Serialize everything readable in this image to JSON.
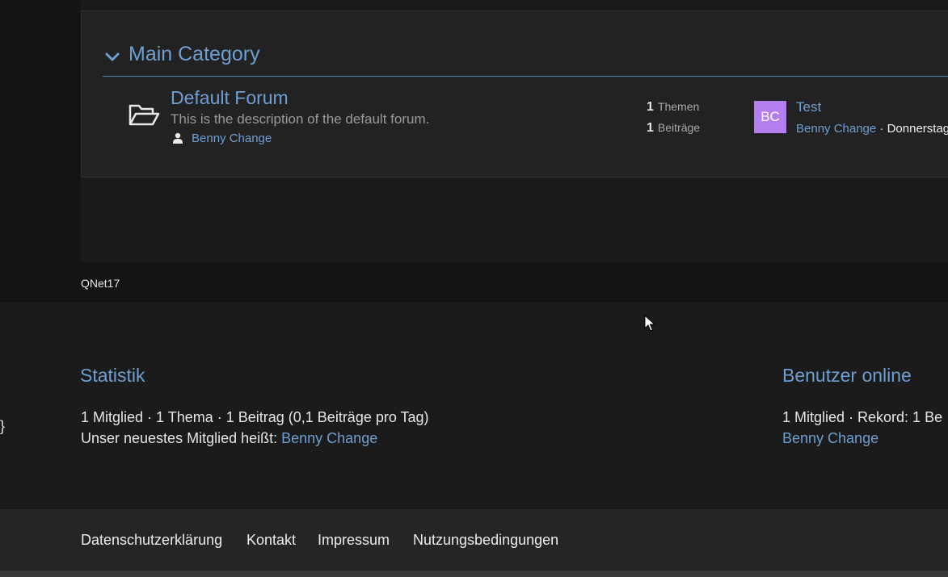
{
  "category": {
    "title": "Main Category"
  },
  "forum": {
    "title": "Default Forum",
    "description": "This is the description of the default forum.",
    "moderator": "Benny Change",
    "stats": {
      "topics_count": "1",
      "topics_label": "Themen",
      "posts_count": "1",
      "posts_label": "Beiträge"
    },
    "last_post": {
      "avatar_initials": "BC",
      "avatar_color": "#b37ff0",
      "title": "Test",
      "author": "Benny Change",
      "separator": " · ",
      "date": "Donnerstag"
    }
  },
  "brand": {
    "name": "QNet17"
  },
  "statistics": {
    "title": "Statistik",
    "line1_parts": [
      "1 Mitglied",
      "1 Thema",
      "1 Beitrag (0,1 Beiträge pro Tag)"
    ],
    "line1": "1 Mitglied · 1 Thema · 1 Beitrag (0,1 Beiträge pro Tag)",
    "newest_prefix": "Unser neuestes Mitglied heißt: ",
    "newest_member": "Benny Change"
  },
  "online": {
    "title": "Benutzer online",
    "line1": "1 Mitglied  · Rekord: 1 Be",
    "member": "Benny Change"
  },
  "stray_text": "}",
  "footer": {
    "links": [
      "Datenschutzerklärung",
      "Kontakt",
      "Impressum",
      "Nutzungsbedingungen"
    ]
  },
  "colors": {
    "accent": "#6f9fd2",
    "background": "#1d1d1d"
  }
}
